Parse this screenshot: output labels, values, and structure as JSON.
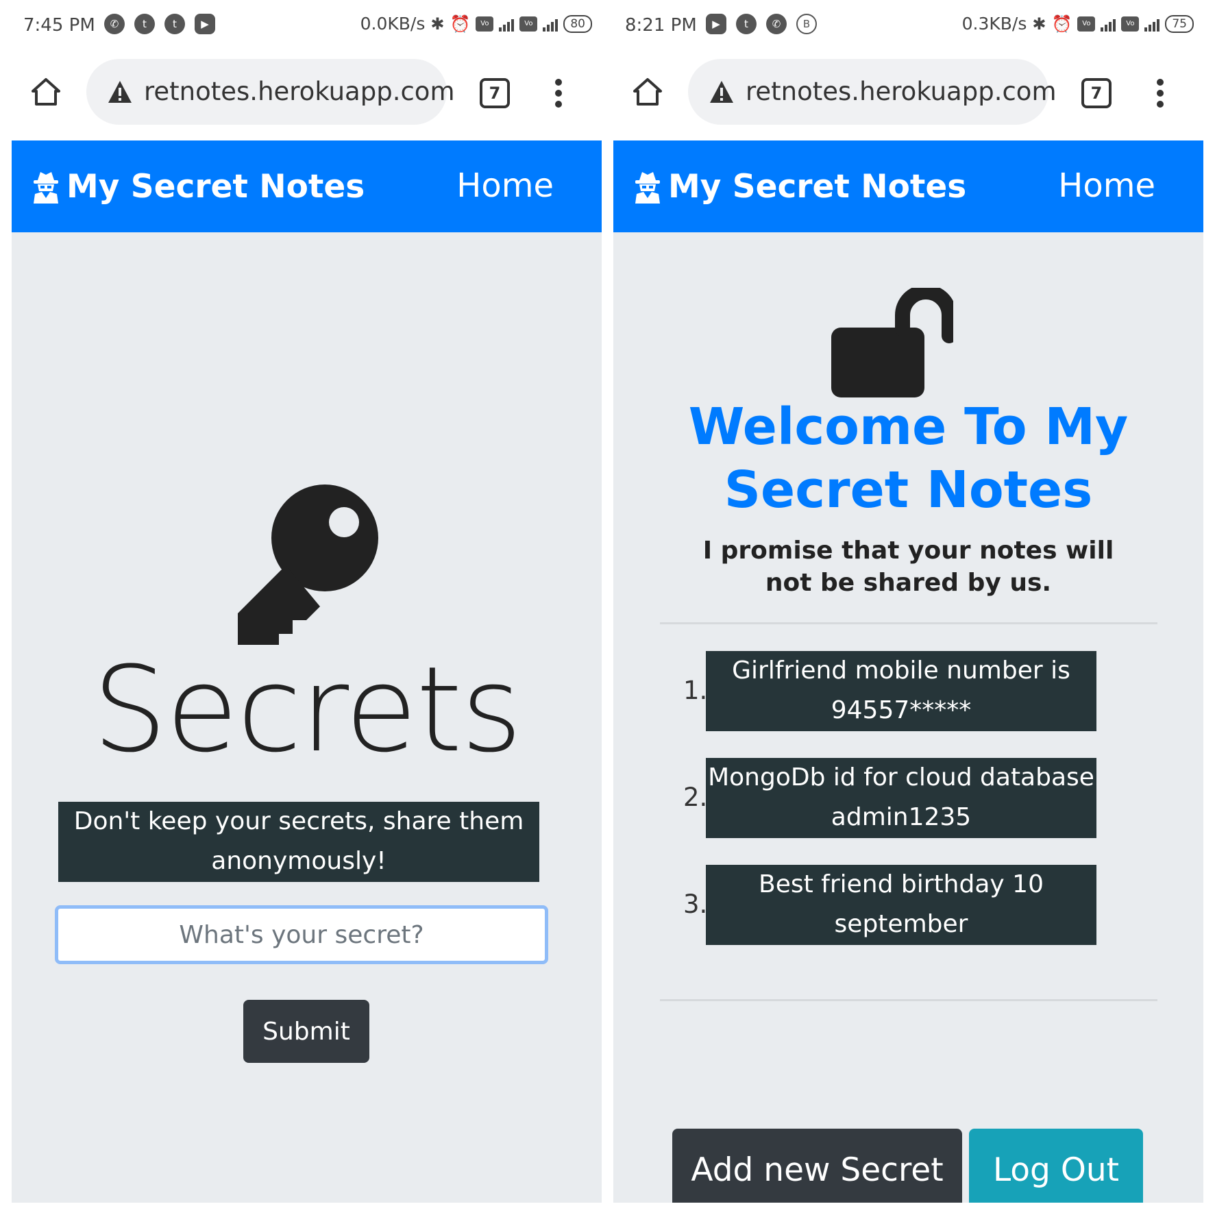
{
  "left": {
    "status": {
      "time": "7:45 PM",
      "apps": [
        "whatsapp-icon",
        "twitter-icon",
        "twitter-icon",
        "youtube-icon"
      ],
      "net_speed": "0.0KB/s",
      "battery": "80"
    },
    "browser": {
      "url": "retnotes.herokuapp.com",
      "tab_count": "7"
    },
    "navbar": {
      "brand": "My Secret Notes",
      "home_link": "Home"
    },
    "content": {
      "title": "Secrets",
      "tagline": "Don't keep your secrets, share them anonymously!",
      "input_placeholder": "What's your secret?",
      "submit_label": "Submit"
    }
  },
  "right": {
    "status": {
      "time": "8:21 PM",
      "apps": [
        "youtube-icon",
        "twitter-icon",
        "whatsapp-icon",
        "b-icon"
      ],
      "net_speed": "0.3KB/s",
      "battery": "75"
    },
    "browser": {
      "url": "retnotes.herokuapp.com",
      "tab_count": "7"
    },
    "navbar": {
      "brand": "My Secret Notes",
      "home_link": "Home"
    },
    "content": {
      "welcome": "Welcome To My Secret Notes",
      "promise": "I promise that your notes will not be shared by us.",
      "notes": [
        {
          "number": "1.",
          "text": "Girlfriend mobile number is 94557*****"
        },
        {
          "number": "2.",
          "text": "MongoDb id for cloud database admin1235"
        },
        {
          "number": "3.",
          "text": "Best friend birthday 10 september"
        }
      ],
      "add_label": "Add new Secret",
      "logout_label": "Log Out"
    }
  },
  "colors": {
    "navbar": "#007bff",
    "page_bg": "#e9ecef",
    "note_bg": "#263539",
    "dark_button": "#343a40",
    "logout_button": "#17a2b8",
    "input_focus": "#8fbcf8"
  }
}
